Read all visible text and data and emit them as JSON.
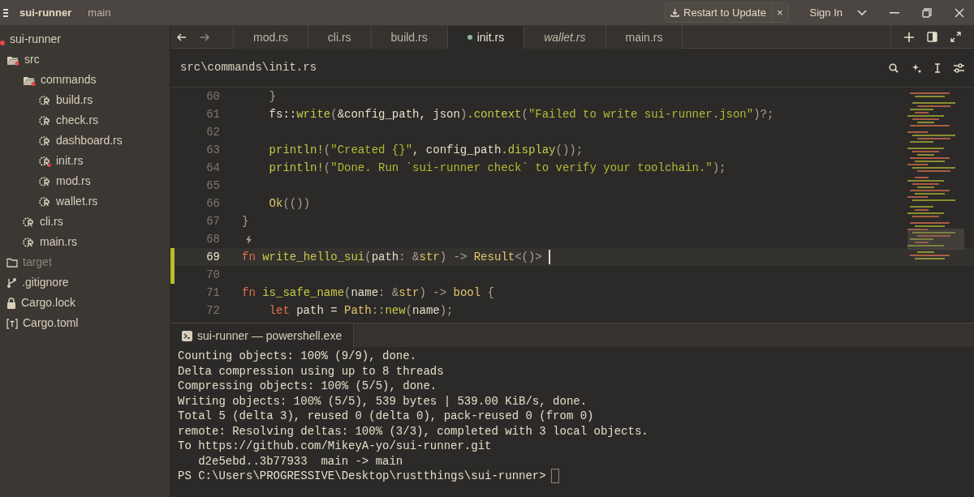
{
  "titlebar": {
    "project": "sui-runner",
    "branch": "main",
    "update_button": "Restart to Update",
    "dismiss": "×",
    "sign_in": "Sign In"
  },
  "sidebar": {
    "items": [
      {
        "label": "sui-runner",
        "kind": "root",
        "error": true,
        "ignored": false,
        "children": [
          {
            "label": "src",
            "kind": "folder",
            "error": true,
            "ignored": false,
            "children": [
              {
                "label": "commands",
                "kind": "folder",
                "error": true,
                "ignored": false,
                "children": [
                  {
                    "label": "build.rs",
                    "kind": "rust",
                    "error": false,
                    "ignored": false
                  },
                  {
                    "label": "check.rs",
                    "kind": "rust",
                    "error": false,
                    "ignored": false
                  },
                  {
                    "label": "dashboard.rs",
                    "kind": "rust",
                    "error": false,
                    "ignored": false
                  },
                  {
                    "label": "init.rs",
                    "kind": "rust",
                    "error": true,
                    "ignored": false
                  },
                  {
                    "label": "mod.rs",
                    "kind": "rust",
                    "error": false,
                    "ignored": false
                  },
                  {
                    "label": "wallet.rs",
                    "kind": "rust",
                    "error": false,
                    "ignored": false
                  }
                ]
              },
              {
                "label": "cli.rs",
                "kind": "rust",
                "error": false,
                "ignored": false
              },
              {
                "label": "main.rs",
                "kind": "rust",
                "error": false,
                "ignored": false
              }
            ]
          },
          {
            "label": "target",
            "kind": "folder-closed",
            "error": false,
            "ignored": true
          },
          {
            "label": ".gitignore",
            "kind": "git",
            "error": false,
            "ignored": false
          },
          {
            "label": "Cargo.lock",
            "kind": "lock",
            "error": false,
            "ignored": false
          },
          {
            "label": "Cargo.toml",
            "kind": "toml",
            "error": false,
            "ignored": false
          }
        ]
      }
    ]
  },
  "tabs": [
    {
      "label": "mod.rs",
      "selected": false,
      "modified": false,
      "preview": false
    },
    {
      "label": "cli.rs",
      "selected": false,
      "modified": false,
      "preview": false
    },
    {
      "label": "build.rs",
      "selected": false,
      "modified": false,
      "preview": false
    },
    {
      "label": "init.rs",
      "selected": true,
      "modified": true,
      "preview": false
    },
    {
      "label": "wallet.rs",
      "selected": false,
      "modified": false,
      "preview": true
    },
    {
      "label": "main.rs",
      "selected": false,
      "modified": false,
      "preview": false
    }
  ],
  "breadcrumb": "src\\commands\\init.rs",
  "editor": {
    "lines": [
      {
        "number": "60",
        "current": false,
        "changed": false,
        "hint": false,
        "tokens": [
          {
            "text": "    }",
            "kind": "punct"
          }
        ]
      },
      {
        "number": "61",
        "current": false,
        "changed": false,
        "hint": false,
        "tokens": [
          {
            "text": "    fs::",
            "kind": "plain"
          },
          {
            "text": "write",
            "kind": "func"
          },
          {
            "text": "(",
            "kind": "punct"
          },
          {
            "text": "&config_path, json",
            "kind": "plain"
          },
          {
            "text": ")",
            "kind": "punct"
          },
          {
            "text": ".context",
            "kind": "func"
          },
          {
            "text": "(",
            "kind": "punct"
          },
          {
            "text": "\"Failed to write sui-runner.json\"",
            "kind": "string"
          },
          {
            "text": ")?;",
            "kind": "punct"
          }
        ]
      },
      {
        "number": "62",
        "current": false,
        "changed": false,
        "hint": false
      },
      {
        "number": "63",
        "current": false,
        "changed": false,
        "hint": false,
        "tokens": [
          {
            "text": "    println!",
            "kind": "func"
          },
          {
            "text": "(",
            "kind": "punct"
          },
          {
            "text": "\"Created {}\"",
            "kind": "string"
          },
          {
            "text": ", config_path",
            "kind": "plain"
          },
          {
            "text": ".display",
            "kind": "func"
          },
          {
            "text": "());",
            "kind": "punct"
          }
        ]
      },
      {
        "number": "64",
        "current": false,
        "changed": false,
        "hint": false,
        "tokens": [
          {
            "text": "    println!",
            "kind": "func"
          },
          {
            "text": "(",
            "kind": "punct"
          },
          {
            "text": "\"Done. Run `sui-runner check` to verify your toolchain.\"",
            "kind": "string"
          },
          {
            "text": ");",
            "kind": "punct"
          }
        ]
      },
      {
        "number": "65",
        "current": false,
        "changed": false,
        "hint": false
      },
      {
        "number": "66",
        "current": false,
        "changed": false,
        "hint": false,
        "tokens": [
          {
            "text": "    Ok",
            "kind": "type"
          },
          {
            "text": "(())",
            "kind": "punct"
          }
        ]
      },
      {
        "number": "67",
        "current": false,
        "changed": false,
        "hint": false,
        "tokens": [
          {
            "text": "}",
            "kind": "punct"
          }
        ]
      },
      {
        "number": "68",
        "current": false,
        "changed": false,
        "hint": true
      },
      {
        "number": "69",
        "current": true,
        "changed": true,
        "hint": false,
        "tokens": [
          {
            "text": "fn ",
            "kind": "keyword"
          },
          {
            "text": "write_hello_sui",
            "kind": "func"
          },
          {
            "text": "(",
            "kind": "punct"
          },
          {
            "text": "path",
            "kind": "plain"
          },
          {
            "text": ": &",
            "kind": "punct"
          },
          {
            "text": "str",
            "kind": "type"
          },
          {
            "text": ") -> ",
            "kind": "punct"
          },
          {
            "text": "Result",
            "kind": "type"
          },
          {
            "text": "<()>",
            "kind": "punct"
          }
        ]
      },
      {
        "number": "70",
        "current": false,
        "changed": true,
        "hint": false
      },
      {
        "number": "71",
        "current": false,
        "changed": false,
        "hint": false,
        "tokens": [
          {
            "text": "fn ",
            "kind": "keyword"
          },
          {
            "text": "is_safe_name",
            "kind": "func"
          },
          {
            "text": "(",
            "kind": "punct"
          },
          {
            "text": "name",
            "kind": "plain"
          },
          {
            "text": ": &",
            "kind": "punct"
          },
          {
            "text": "str",
            "kind": "type"
          },
          {
            "text": ") -> ",
            "kind": "punct"
          },
          {
            "text": "bool",
            "kind": "type"
          },
          {
            "text": " {",
            "kind": "punct"
          }
        ]
      },
      {
        "number": "72",
        "current": false,
        "changed": false,
        "hint": false,
        "tokens": [
          {
            "text": "    let ",
            "kind": "keyword"
          },
          {
            "text": "path = ",
            "kind": "plain"
          },
          {
            "text": "Path",
            "kind": "type"
          },
          {
            "text": "::",
            "kind": "punct"
          },
          {
            "text": "new",
            "kind": "func"
          },
          {
            "text": "(",
            "kind": "punct"
          },
          {
            "text": "name",
            "kind": "plain"
          },
          {
            "text": ");",
            "kind": "punct"
          }
        ]
      }
    ]
  },
  "terminal": {
    "tab": "sui-runner — powershell.exe",
    "lines": [
      "Counting objects: 100% (9/9), done.",
      "Delta compression using up to 8 threads",
      "Compressing objects: 100% (5/5), done.",
      "Writing objects: 100% (5/5), 539 bytes | 539.00 KiB/s, done.",
      "Total 5 (delta 3), reused 0 (delta 0), pack-reused 0 (from 0)",
      "remote: Resolving deltas: 100% (3/3), completed with 3 local objects.",
      "To https://github.com/MikeyA-yo/sui-runner.git",
      "   d2e5ebd..3b77933  main -> main"
    ],
    "prompt": "PS C:\\Users\\PROGRESSIVE\\Desktop\\rustthings\\sui-runner>"
  }
}
